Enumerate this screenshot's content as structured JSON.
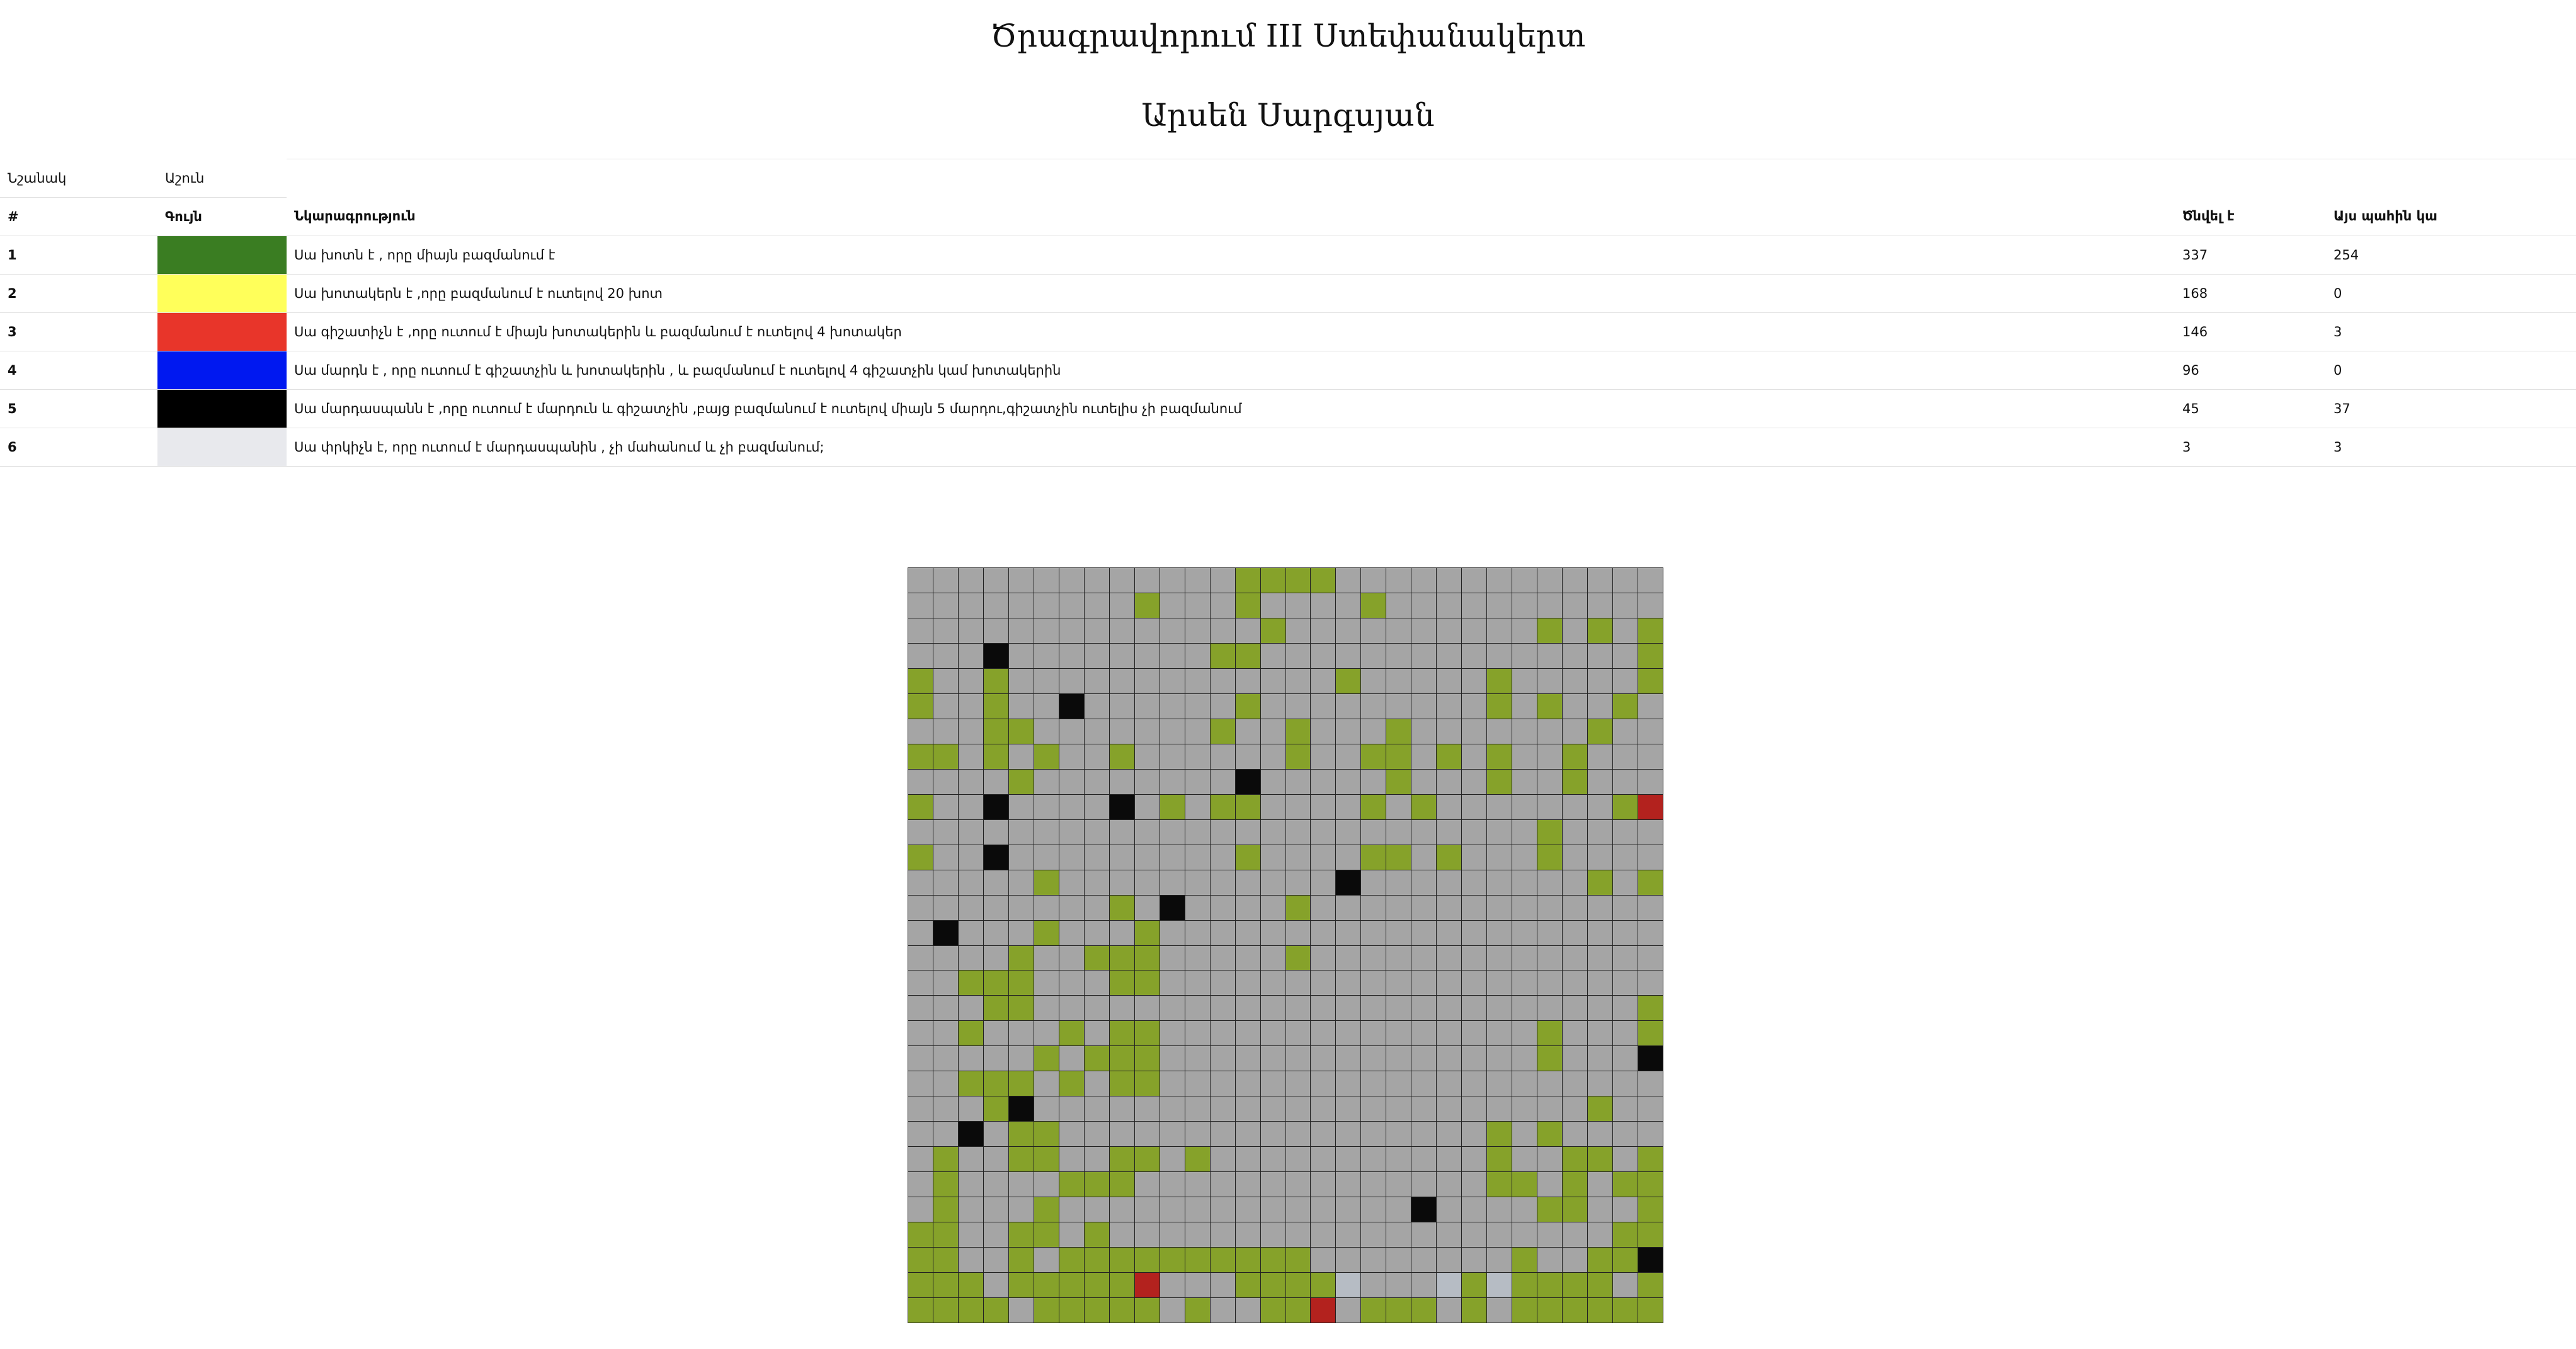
{
  "header": {
    "title": "Ծրագրավորում III Ստեփանակերտ",
    "author": "Արսեն Սարգսյան"
  },
  "meta": {
    "label": "Նշանակ",
    "value": "Աշուն"
  },
  "table": {
    "headers": [
      "#",
      "Գույն",
      "Նկարագրություն",
      "Ծնվել է",
      "Այս պահին կա"
    ],
    "rows": [
      {
        "num": "1",
        "color": "#3a7d22",
        "desc": "Սա խոտն է , որը միայն բազմանում է",
        "born": "337",
        "now": "254"
      },
      {
        "num": "2",
        "color": "#ffff5a",
        "desc": "Սա խոտակերն է ,որը բազմանում է ուտելով 20 խոտ",
        "born": "168",
        "now": "0"
      },
      {
        "num": "3",
        "color": "#e8352a",
        "desc": "Սա գիշատիչն է ,որը ուտում է միայն խոտակերին և բազմանում է ուտելով 4 խոտակեր",
        "born": "146",
        "now": "3"
      },
      {
        "num": "4",
        "color": "#0018f0",
        "desc": "Սա մարդն է , որը ուտում է գիշատչին և խոտակերին , և բազմանում է ուտելով 4 գիշատչին կամ խոտակերին",
        "born": "96",
        "now": "0"
      },
      {
        "num": "5",
        "color": "#000000",
        "desc": "Սա մարդասպանն է ,որը ուտում է մարդուն և գիշատչին ,բայց բազմանում է ուտելով միայն 5 մարդու,գիշատչին ուտելիս չի բազմանում",
        "born": "45",
        "now": "37"
      },
      {
        "num": "6",
        "color": "#e8e9ed",
        "desc": "Սա փրկիչն է, որը ուտում է մարդասպանին , չի մահանում և չի բազմանում;",
        "born": "3",
        "now": "3"
      }
    ]
  },
  "grid": {
    "size": 30,
    "palette": {
      "0": "#a5a5a5",
      "1": "#86a22a",
      "3": "#b3221e",
      "5": "#0a0a0a",
      "6": "#b6bcc4"
    },
    "rows": [
      "000000000000011110000000000000",
      "000000000100010000100000000000",
      "000000000000001000000000010101",
      "000500000000110000000000000001",
      "100100000000000001000001000001",
      "100100500000010000000001010010",
      "000110000000100100010000000100",
      "110101001000000100110101001000",
      "000010000000050000010001001000",
      "100500005010110000101000000013",
      "000000000000000000000000010000",
      "100500000000010000110100010000",
      "000001000000000005000000000101",
      "000000001050000100000000000000",
      "050001000100000000000000000000",
      "000010011100000100000000000000",
      "001110001100000000000000000000",
      "000110000000000000000000000001",
      "001000101100000000000000010001",
      "000001011100000000000000010005",
      "001110101100000000000000000000",
      "000150000000000000000000000100",
      "005011000000000000000001010000",
      "010011001101000000000001001101",
      "010000111000000000000001101011",
      "010001000000000000005000011001",
      "110011010000000000000000000011",
      "110010111111111100000000100115",
      "111011111300011116000616111101",
      "111101111101001130111010111111"
    ]
  }
}
